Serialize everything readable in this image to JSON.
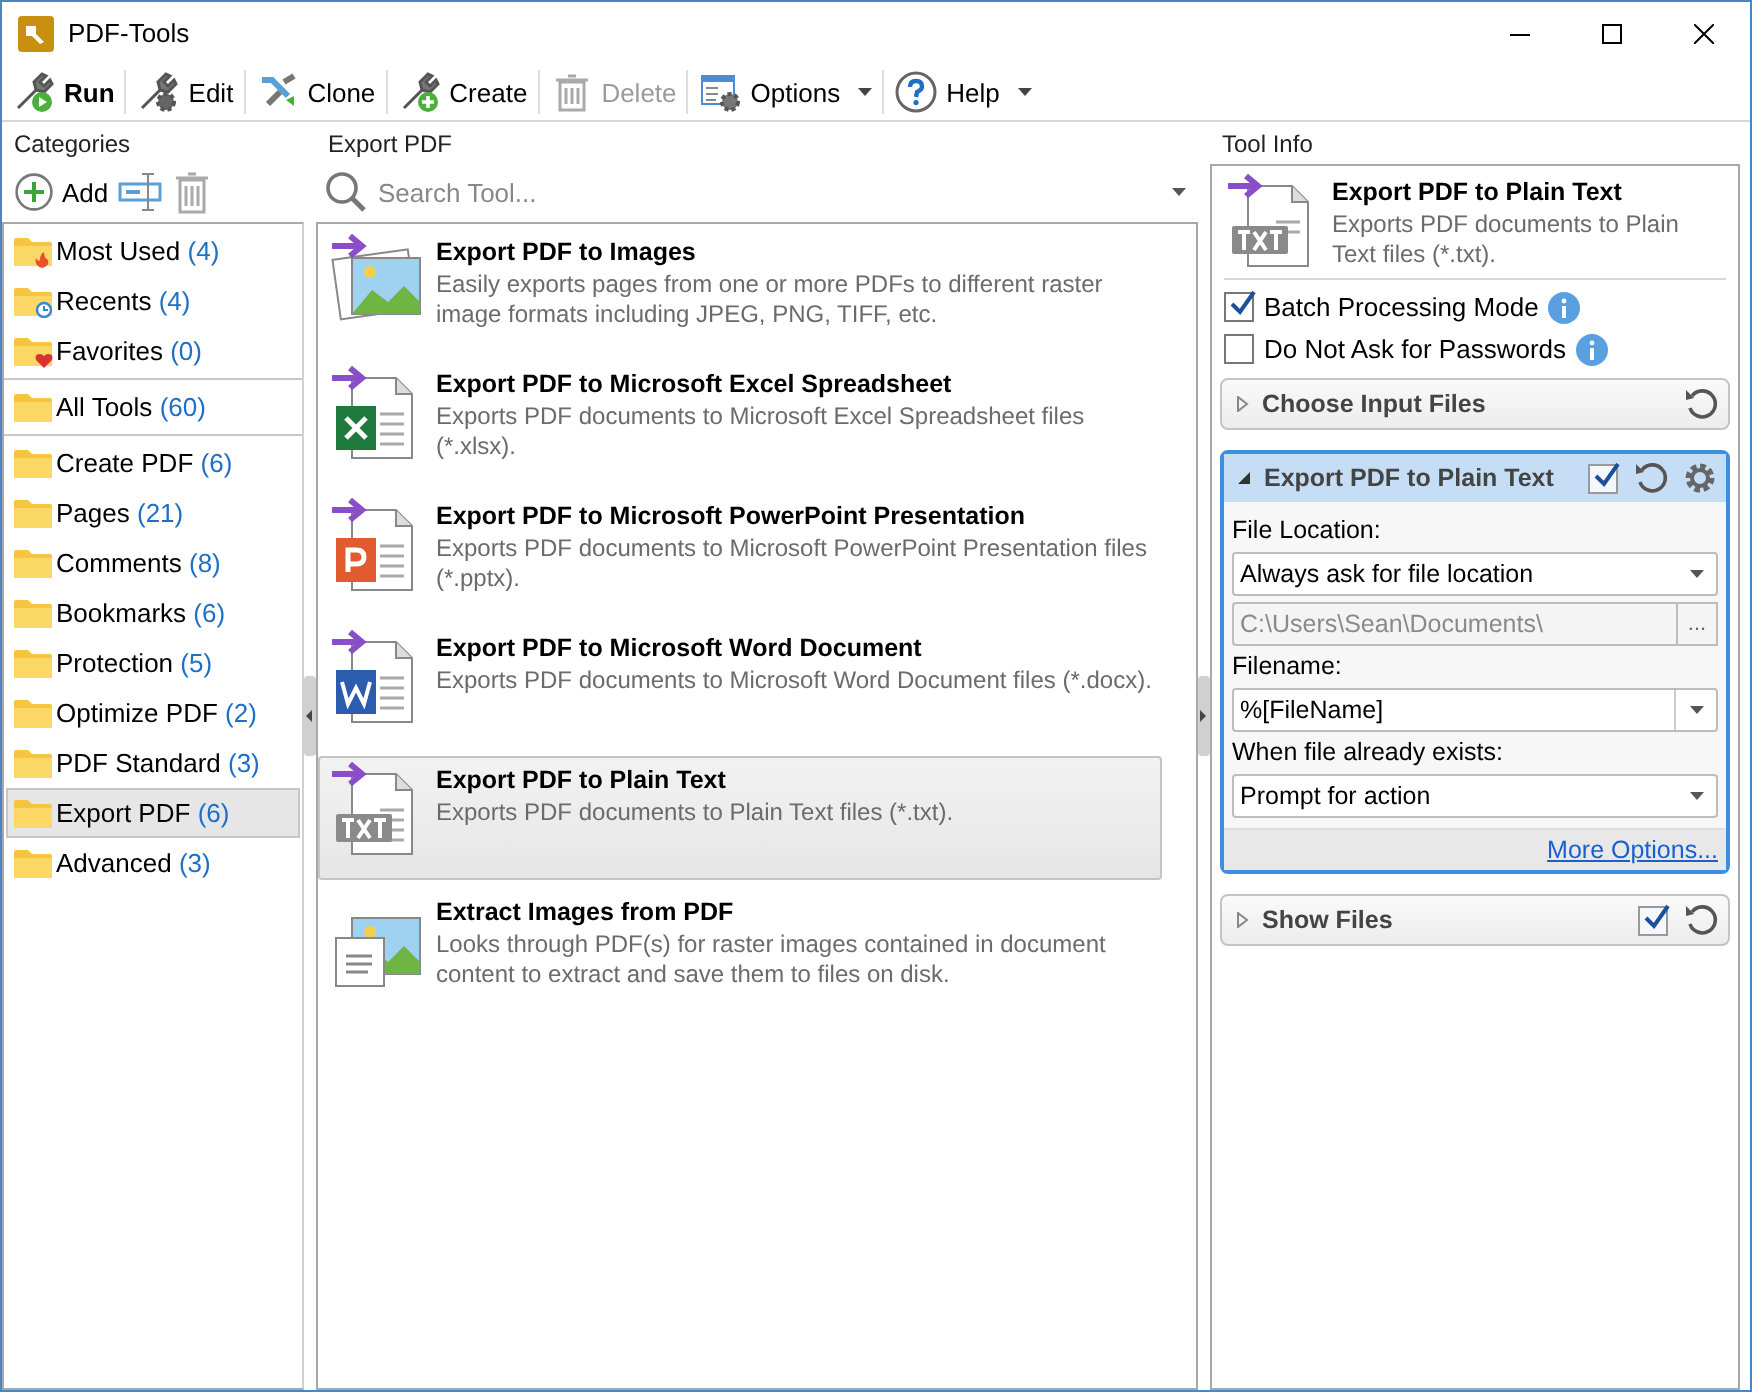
{
  "window": {
    "title": "PDF-Tools"
  },
  "toolbar": [
    {
      "label": "Run",
      "kind": "run",
      "bold": true,
      "disabled": false,
      "dropdown": false
    },
    {
      "label": "Edit",
      "kind": "edit",
      "bold": false,
      "disabled": false,
      "dropdown": false
    },
    {
      "label": "Clone",
      "kind": "clone",
      "bold": false,
      "disabled": false,
      "dropdown": false
    },
    {
      "label": "Create",
      "kind": "create",
      "bold": false,
      "disabled": false,
      "dropdown": false
    },
    {
      "label": "Delete",
      "kind": "delete",
      "bold": false,
      "disabled": true,
      "dropdown": false
    },
    {
      "label": "Options",
      "kind": "options",
      "bold": false,
      "disabled": false,
      "dropdown": true
    },
    {
      "label": "Help",
      "kind": "help",
      "bold": false,
      "disabled": false,
      "dropdown": true
    }
  ],
  "categories": {
    "title": "Categories",
    "add_label": "Add",
    "groups": [
      [
        {
          "name": "Most Used",
          "count": "(4)",
          "kind": "hot",
          "selected": false
        },
        {
          "name": "Recents",
          "count": "(4)",
          "kind": "recent",
          "selected": false
        },
        {
          "name": "Favorites",
          "count": "(0)",
          "kind": "favorite",
          "selected": false
        }
      ],
      [
        {
          "name": "All Tools",
          "count": "(60)",
          "kind": "folder",
          "selected": false
        }
      ],
      [
        {
          "name": "Create PDF",
          "count": "(6)",
          "kind": "folder",
          "selected": false
        },
        {
          "name": "Pages",
          "count": "(21)",
          "kind": "folder",
          "selected": false
        },
        {
          "name": "Comments",
          "count": "(8)",
          "kind": "folder",
          "selected": false
        },
        {
          "name": "Bookmarks",
          "count": "(6)",
          "kind": "folder",
          "selected": false
        },
        {
          "name": "Protection",
          "count": "(5)",
          "kind": "folder",
          "selected": false
        },
        {
          "name": "Optimize PDF",
          "count": "(2)",
          "kind": "folder",
          "selected": false
        },
        {
          "name": "PDF Standard",
          "count": "(3)",
          "kind": "folder",
          "selected": false
        },
        {
          "name": "Export PDF",
          "count": "(6)",
          "kind": "folder",
          "selected": true
        },
        {
          "name": "Advanced",
          "count": "(3)",
          "kind": "folder",
          "selected": false
        }
      ]
    ]
  },
  "tools": {
    "title": "Export PDF",
    "search": {
      "placeholder": "Search Tool..."
    },
    "items": [
      {
        "title": "Export PDF to Images",
        "description": "Easily exports pages from one or more PDFs to different raster image formats including JPEG, PNG, TIFF, etc.",
        "kind": "images",
        "selected": false
      },
      {
        "title": "Export PDF to Microsoft Excel Spreadsheet",
        "description": "Exports PDF documents to Microsoft Excel Spreadsheet files (*.xlsx).",
        "kind": "excel",
        "selected": false
      },
      {
        "title": "Export PDF to Microsoft PowerPoint Presentation",
        "description": "Exports PDF documents to Microsoft PowerPoint Presentation files (*.pptx).",
        "kind": "powerpoint",
        "selected": false
      },
      {
        "title": "Export PDF to Microsoft Word Document",
        "description": "Exports PDF documents to Microsoft Word Document files (*.docx).",
        "kind": "word",
        "selected": false
      },
      {
        "title": "Export PDF to Plain Text",
        "description": "Exports PDF documents to Plain Text files (*.txt).",
        "kind": "text",
        "selected": true
      },
      {
        "title": "Extract Images from PDF",
        "description": "Looks through PDF(s) for raster images contained in document content to extract and save them to files on disk.",
        "kind": "extract",
        "selected": false
      }
    ]
  },
  "tool_info": {
    "title": "Tool Info",
    "tool": {
      "title": "Export PDF to Plain Text",
      "description": "Exports PDF documents to Plain Text files (*.txt).",
      "kind": "text"
    },
    "options": [
      {
        "label": "Batch Processing Mode",
        "checked": true
      },
      {
        "label": "Do Not Ask for Passwords",
        "checked": false
      }
    ],
    "sections": [
      {
        "title": "Choose Input Files",
        "kind": "input",
        "expanded": false
      },
      {
        "title": "Export PDF to Plain Text",
        "kind": "operation",
        "expanded": true,
        "checked": true,
        "fields": [
          {
            "kind": "label",
            "text": "File Location:"
          },
          {
            "kind": "dropdown",
            "value": "Always ask for file location"
          },
          {
            "kind": "path",
            "value": "C:\\Users\\Sean\\Documents\\",
            "browse": "...",
            "disabled": true
          },
          {
            "kind": "label",
            "text": "Filename:"
          },
          {
            "kind": "combo",
            "value": "%[FileName]"
          },
          {
            "kind": "label",
            "text": "When file already exists:"
          },
          {
            "kind": "dropdown",
            "value": "Prompt for action"
          }
        ],
        "link": "More Options..."
      },
      {
        "title": "Show Files",
        "kind": "output",
        "expanded": false,
        "checked": true
      }
    ]
  }
}
